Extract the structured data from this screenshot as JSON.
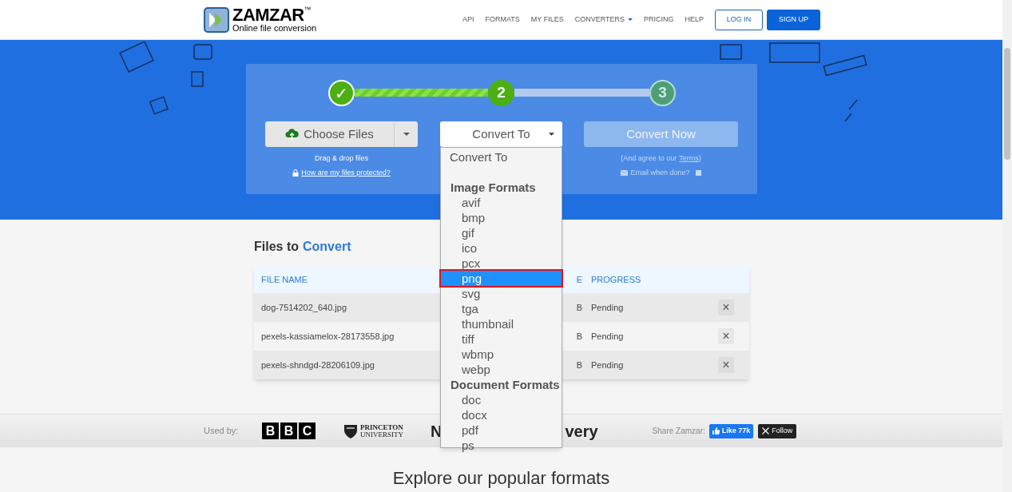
{
  "header": {
    "logo_title": "ZAMZAR",
    "logo_tm": "™",
    "logo_subtitle": "Online file conversion",
    "nav": [
      {
        "label": "API",
        "dropdown": false
      },
      {
        "label": "FORMATS",
        "dropdown": false
      },
      {
        "label": "MY FILES",
        "dropdown": false
      },
      {
        "label": "CONVERTERS",
        "dropdown": true
      },
      {
        "label": "PRICING",
        "dropdown": false
      },
      {
        "label": "HELP",
        "dropdown": false
      }
    ],
    "login": "LOG IN",
    "signup": "SIGN UP"
  },
  "steps": [
    {
      "label": "✓",
      "kind": "done"
    },
    {
      "label": "2",
      "kind": "current"
    },
    {
      "label": "3",
      "kind": "pending"
    }
  ],
  "choose_files": {
    "label": "Choose Files",
    "hint": "Drag & drop files",
    "link": "How are my files protected?"
  },
  "convert_to": {
    "label": "Convert To",
    "expanded": true,
    "placeholder": "Convert To",
    "groups": [
      {
        "label": "Image Formats",
        "options": [
          {
            "label": "avif",
            "selected": false
          },
          {
            "label": "bmp",
            "selected": false
          },
          {
            "label": "gif",
            "selected": false
          },
          {
            "label": "ico",
            "selected": false
          },
          {
            "label": "pcx",
            "selected": false
          },
          {
            "label": "png",
            "selected": true
          },
          {
            "label": "svg",
            "selected": false
          },
          {
            "label": "tga",
            "selected": false
          },
          {
            "label": "thumbnail",
            "selected": false
          },
          {
            "label": "tiff",
            "selected": false
          },
          {
            "label": "wbmp",
            "selected": false
          },
          {
            "label": "webp",
            "selected": false
          }
        ]
      },
      {
        "label": "Document Formats",
        "options": [
          {
            "label": "doc",
            "selected": false
          },
          {
            "label": "docx",
            "selected": false
          },
          {
            "label": "pdf",
            "selected": false
          },
          {
            "label": "ps",
            "selected": false
          }
        ]
      }
    ]
  },
  "convert_now": {
    "label": "Convert Now",
    "disabled": true,
    "note": "(And agree to our",
    "link": "Terms",
    "note_end": ")",
    "email_label": "Email when done?",
    "email_checked": false
  },
  "files": {
    "title": "Files to",
    "title_accent": "Convert",
    "columns": [
      "FILE NAME",
      "E",
      "PROGRESS"
    ],
    "rows": [
      {
        "name": "dog-7514202_640.jpg",
        "size": "B",
        "progress": "Pending"
      },
      {
        "name": "pexels-kassiamelox-28173558.jpg",
        "size": "B",
        "progress": "Pending"
      },
      {
        "name": "pexels-shndgd-28206109.jpg",
        "size": "B",
        "progress": "Pending"
      }
    ],
    "remove": "×"
  },
  "footer": {
    "used_by": "Used by:",
    "bbc": [
      "B",
      "B",
      "C"
    ],
    "princeton": [
      "PRINCETON",
      "UNIVERSITY"
    ],
    "partial_logo": "N",
    "partial_logo_2": "very",
    "share": "Share Zamzar:",
    "like": "Like 77k",
    "follow": "Follow"
  },
  "explore": "Explore our popular formats"
}
